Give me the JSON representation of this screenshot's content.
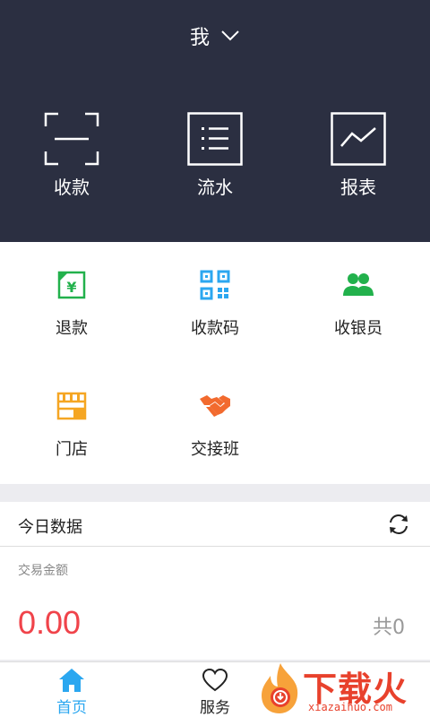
{
  "header": {
    "store_name": "我",
    "actions": [
      {
        "label": "收款",
        "icon": "scan-icon"
      },
      {
        "label": "流水",
        "icon": "list-icon"
      },
      {
        "label": "报表",
        "icon": "chart-icon"
      }
    ]
  },
  "grid": {
    "items": [
      {
        "label": "退款",
        "icon": "refund-icon",
        "color": "#22b14c"
      },
      {
        "label": "收款码",
        "icon": "qr-code-icon",
        "color": "#2ba7f0"
      },
      {
        "label": "收银员",
        "icon": "cashiers-icon",
        "color": "#22b14c"
      },
      {
        "label": "门店",
        "icon": "store-icon",
        "color": "#f5a623"
      },
      {
        "label": "交接班",
        "icon": "handshake-icon",
        "color": "#f26a2e"
      }
    ]
  },
  "today": {
    "title": "今日数据",
    "amount_label": "交易金额",
    "amount": "0.00",
    "count": "共0"
  },
  "bottom_nav": {
    "tabs": [
      {
        "label": "首页",
        "icon": "home-icon",
        "active": true
      },
      {
        "label": "服务",
        "icon": "heart-icon",
        "active": false
      }
    ]
  },
  "watermark": {
    "text": "下载火",
    "url": "xiazaihuo.com"
  },
  "colors": {
    "header_bg": "#2b2f41",
    "accent_blue": "#2ba7f0",
    "amount_red": "#f0434a",
    "watermark_red": "#e8412c"
  }
}
